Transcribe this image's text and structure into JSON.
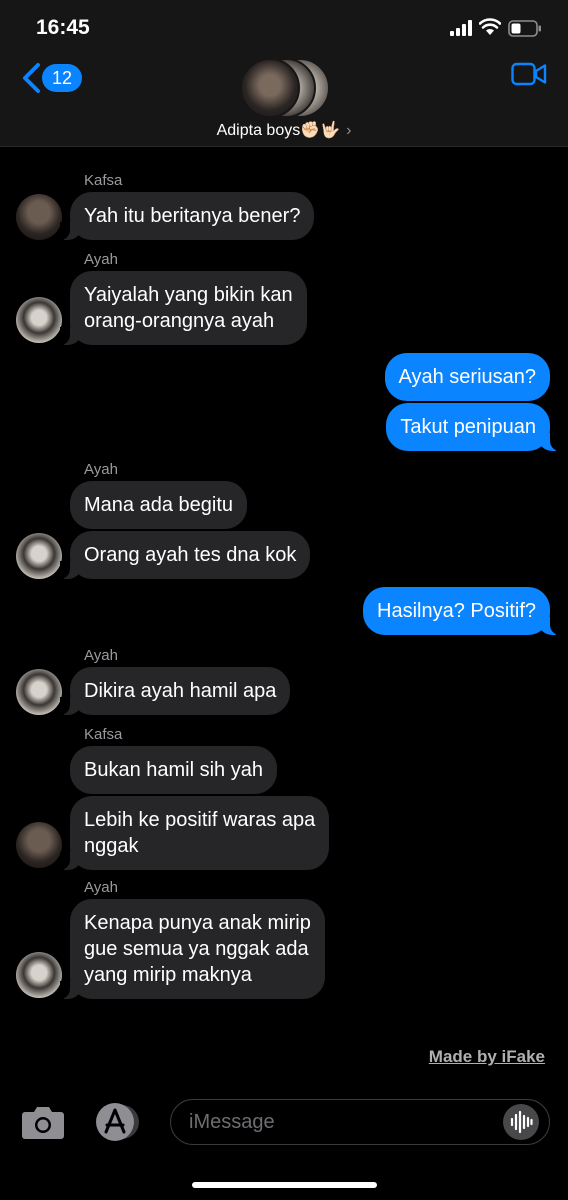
{
  "status_bar": {
    "time": "16:45"
  },
  "header": {
    "back_badge": "12",
    "group_name": "Adipta boys✊🏻🤟🏻",
    "chevron": "›"
  },
  "messages": [
    {
      "sender": "Kafsa",
      "text": "Yah itu beritanya bener?"
    },
    {
      "sender": "Ayah",
      "text": "Yaiyalah yang bikin kan\norang-orangnya ayah"
    },
    {
      "sender": "me",
      "text": "Ayah seriusan?"
    },
    {
      "sender": "me",
      "text": "Takut penipuan"
    },
    {
      "sender": "Ayah",
      "text": "Mana ada begitu"
    },
    {
      "sender": "Ayah",
      "text": "Orang ayah tes dna kok"
    },
    {
      "sender": "me",
      "text": "Hasilnya? Positif?"
    },
    {
      "sender": "Ayah",
      "text": "Dikira ayah hamil apa"
    },
    {
      "sender": "Kafsa",
      "text": "Bukan hamil sih yah"
    },
    {
      "sender": "Kafsa",
      "text": "Lebih ke positif waras apa\nnggak"
    },
    {
      "sender": "Ayah",
      "text": "Kenapa punya anak mirip\ngue semua ya nggak ada\nyang mirip maknya"
    }
  ],
  "watermark": "Made by iFake",
  "composer": {
    "placeholder": "iMessage"
  },
  "colors": {
    "accent": "#0a84ff",
    "incoming_bubble": "#262628",
    "background": "#000000"
  },
  "icons": [
    "signal-icon",
    "wifi-icon",
    "battery-icon",
    "back-chevron-icon",
    "video-camera-icon",
    "camera-icon",
    "app-store-icon",
    "audio-waveform-icon"
  ]
}
